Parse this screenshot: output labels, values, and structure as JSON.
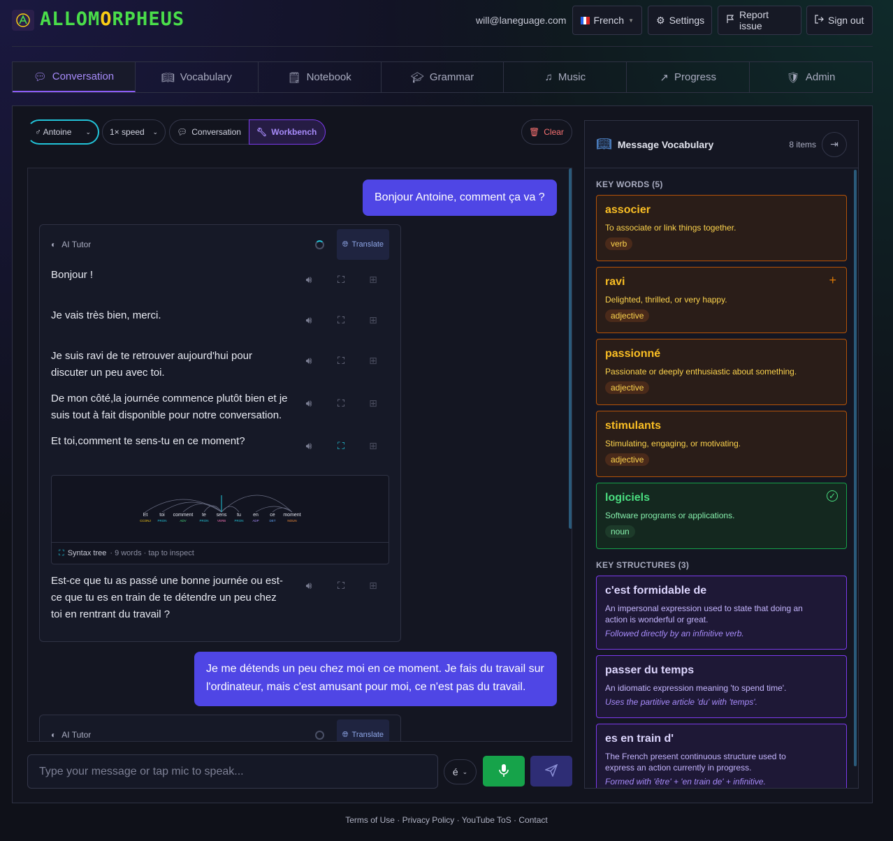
{
  "header": {
    "brand_prefix": "ALLOM",
    "brand_o": "O",
    "brand_suffix": "RPHEUS",
    "email": "will@laneguage.com",
    "language": "French",
    "settings": "Settings",
    "report": "Report issue",
    "signout": "Sign out"
  },
  "tabs": [
    "Conversation",
    "Vocabulary",
    "Notebook",
    "Grammar",
    "Music",
    "Progress",
    "Admin"
  ],
  "controls": {
    "voice": "♂ Antoine",
    "speed": "1× speed",
    "mode_conv": "Conversation",
    "mode_work": "Workbench",
    "clear": "Clear"
  },
  "chat": {
    "user1": "Bonjour Antoine, comment ça va ?",
    "ai_label": "AI Tutor",
    "translate": "Translate",
    "sentences": [
      "Bonjour !",
      "Je vais très bien, merci.",
      "Je suis ravi de te retrouver aujourd'hui pour discuter un peu avec toi.",
      "De mon côté,la journée commence plutôt bien et je suis tout à fait disponible pour notre conversation.",
      "Et toi,comment te sens-tu en ce moment?"
    ],
    "tree_label": "Syntax tree",
    "tree_meta": "· 9 words · tap to inspect",
    "tree_words": [
      "Et",
      "toi",
      "comment",
      "te",
      "sens",
      "tu",
      "en",
      "ce",
      "moment"
    ],
    "tree_pos": [
      "CCONJ",
      "PRON",
      "ADV",
      "PRON",
      "VERB",
      "PRON",
      "ADP",
      "DET",
      "NOUN"
    ],
    "sentence6": "Est-ce que tu as passé une bonne journée ou est-ce que tu es en train de te détendre un peu chez toi en rentrant du travail ?",
    "user2": "Je me détends un peu chez moi en ce moment. Je fais du travail sur l'ordinateur, mais c'est amusant pour moi, ce n'est pas du travail.",
    "input_placeholder": "Type your message or tap mic to speak...",
    "accent": "é"
  },
  "vocab": {
    "title": "Message Vocabulary",
    "count": "8 items",
    "kw_header": "KEY WORDS (5)",
    "ks_header": "KEY STRUCTURES (3)",
    "words": [
      {
        "word": "associer",
        "def": "To associate or link things together.",
        "pos": "verb"
      },
      {
        "word": "ravi",
        "def": "Delighted, thrilled, or very happy.",
        "pos": "adjective"
      },
      {
        "word": "passionné",
        "def": "Passionate or deeply enthusiastic about something.",
        "pos": "adjective"
      },
      {
        "word": "stimulants",
        "def": "Stimulating, engaging, or motivating.",
        "pos": "adjective"
      },
      {
        "word": "logiciels",
        "def": "Software programs or applications.",
        "pos": "noun"
      }
    ],
    "structures": [
      {
        "title": "c'est formidable de",
        "def": "An impersonal expression used to state that doing an action is wonderful or great.",
        "note": "Followed directly by an infinitive verb."
      },
      {
        "title": "passer du temps",
        "def": "An idiomatic expression meaning 'to spend time'.",
        "note": "Uses the partitive article 'du' with 'temps'."
      },
      {
        "title": "es en train d'",
        "def": "The French present continuous structure used to express an action currently in progress.",
        "note": "Formed with 'être' + 'en train de' + infinitive."
      }
    ]
  },
  "footer": {
    "terms": "Terms of Use",
    "privacy": "Privacy Policy",
    "yt": "YouTube ToS",
    "contact": "Contact"
  }
}
